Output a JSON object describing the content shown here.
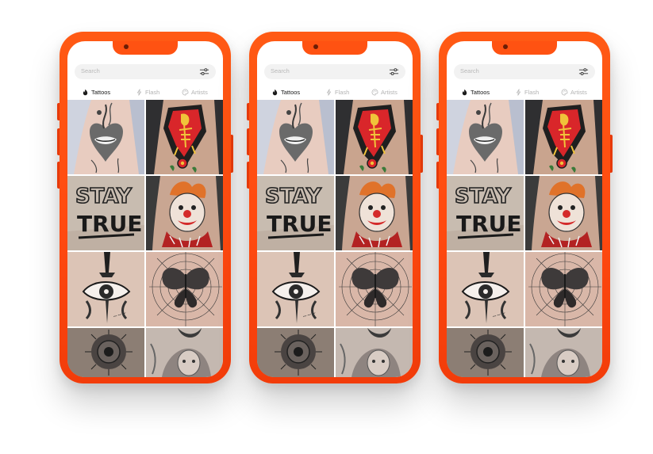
{
  "search": {
    "placeholder": "Search"
  },
  "tabs": [
    {
      "label": "Tattoos",
      "icon": "flame-icon",
      "active": true
    },
    {
      "label": "Flash",
      "icon": "flash-icon",
      "active": false
    },
    {
      "label": "Artists",
      "icon": "palette-icon",
      "active": false
    }
  ],
  "gallery": {
    "tiles": [
      {
        "subject": "heart-lips-tattoo"
      },
      {
        "subject": "skeleton-traditional-tattoo"
      },
      {
        "subject": "stay-true-lettering-tattoo",
        "lettering_top": "STAY",
        "lettering_bottom": "TRUE"
      },
      {
        "subject": "clown-tattoo"
      },
      {
        "subject": "dagger-eye-tattoo"
      },
      {
        "subject": "butterfly-web-tattoo"
      },
      {
        "subject": "mandala-tattoo"
      },
      {
        "subject": "moon-portrait-tattoo"
      }
    ]
  },
  "colors": {
    "phone_frame": "#ff5212",
    "active_tab": "#1a1a1a",
    "inactive_tab": "#b3b3b3"
  }
}
